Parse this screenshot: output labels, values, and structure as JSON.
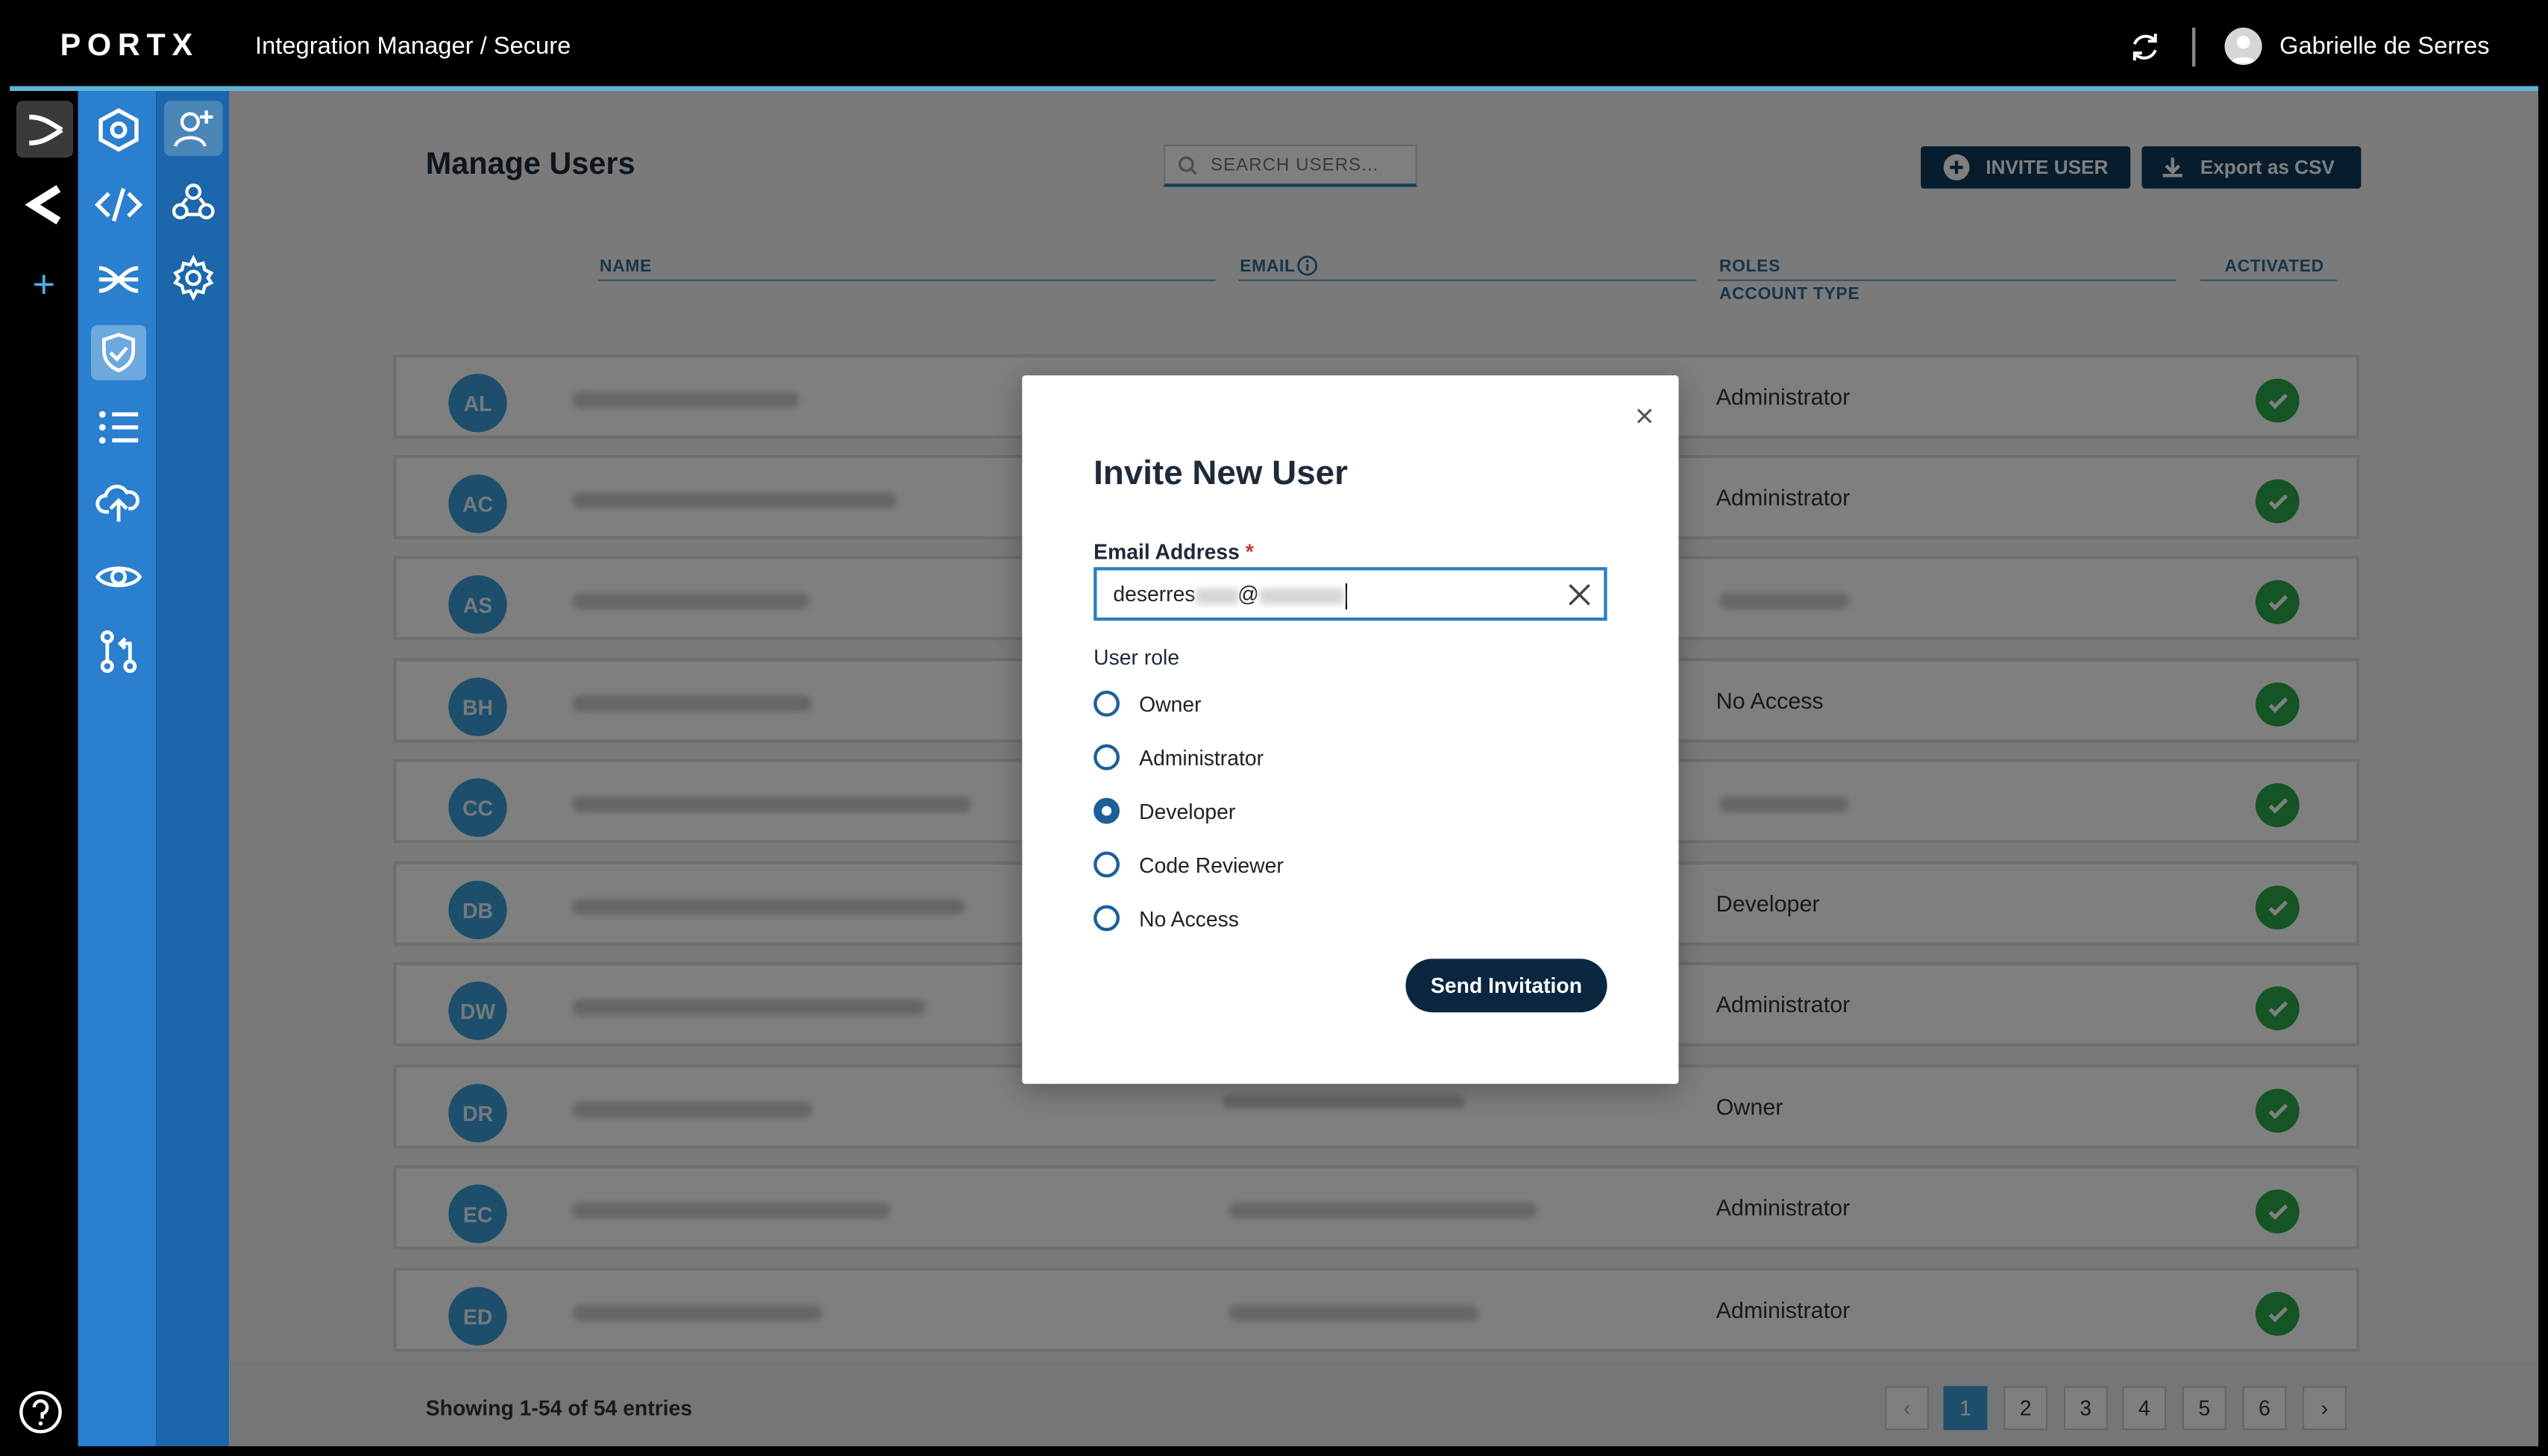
{
  "header": {
    "logo": "PORTX",
    "breadcrumb": "Integration Manager / Secure",
    "user_name": "Gabrielle de Serres"
  },
  "rail_icons": [
    "portx-x-icon",
    "c-brand-icon",
    "add-icon",
    "hexagon-settings-icon",
    "code-icon",
    "shuffle-icon",
    "shield-check-icon",
    "list-icon",
    "cloud-upload-icon",
    "eye-icon",
    "git-pull-request-icon",
    "help-icon"
  ],
  "sub_rail_icons": [
    "add-user-icon",
    "group-icon",
    "gear-icon"
  ],
  "page": {
    "title": "Manage Users",
    "search_placeholder": "SEARCH USERS...",
    "invite_label": "INVITE USER",
    "export_label": "Export as CSV"
  },
  "table": {
    "columns": {
      "name": "NAME",
      "email": "EMAIL",
      "roles": "ROLES",
      "account_type": "ACCOUNT TYPE",
      "activated": "ACTIVATED"
    },
    "rows": [
      {
        "initials": "AL",
        "role": "Administrator"
      },
      {
        "initials": "AC",
        "role": "Administrator"
      },
      {
        "initials": "AS",
        "role": ""
      },
      {
        "initials": "BH",
        "role": "No Access"
      },
      {
        "initials": "CC",
        "role": ""
      },
      {
        "initials": "DB",
        "role": "Developer"
      },
      {
        "initials": "DW",
        "role": "Administrator"
      },
      {
        "initials": "DR",
        "role": "Owner"
      },
      {
        "initials": "EC",
        "role": "Administrator"
      },
      {
        "initials": "ED",
        "role": "Administrator"
      }
    ]
  },
  "footer": {
    "entries": "Showing 1-54 of 54 entries",
    "pages": [
      "1",
      "2",
      "3",
      "4",
      "5",
      "6"
    ],
    "prev": "‹",
    "next": "›"
  },
  "modal": {
    "title": "Invite New User",
    "email_label": "Email Address",
    "required_mark": "*",
    "email_value_prefix": "deserres",
    "email_value_at": "@",
    "role_label": "User role",
    "roles": [
      "Owner",
      "Administrator",
      "Developer",
      "Code Reviewer",
      "No Access"
    ],
    "selected_role": "Developer",
    "send_label": "Send Invitation"
  },
  "colors": {
    "accent": "#2a7fcf",
    "dark_button": "#0f3a5a",
    "activated": "#2aa84a",
    "avatar": "#3a9fd8"
  }
}
